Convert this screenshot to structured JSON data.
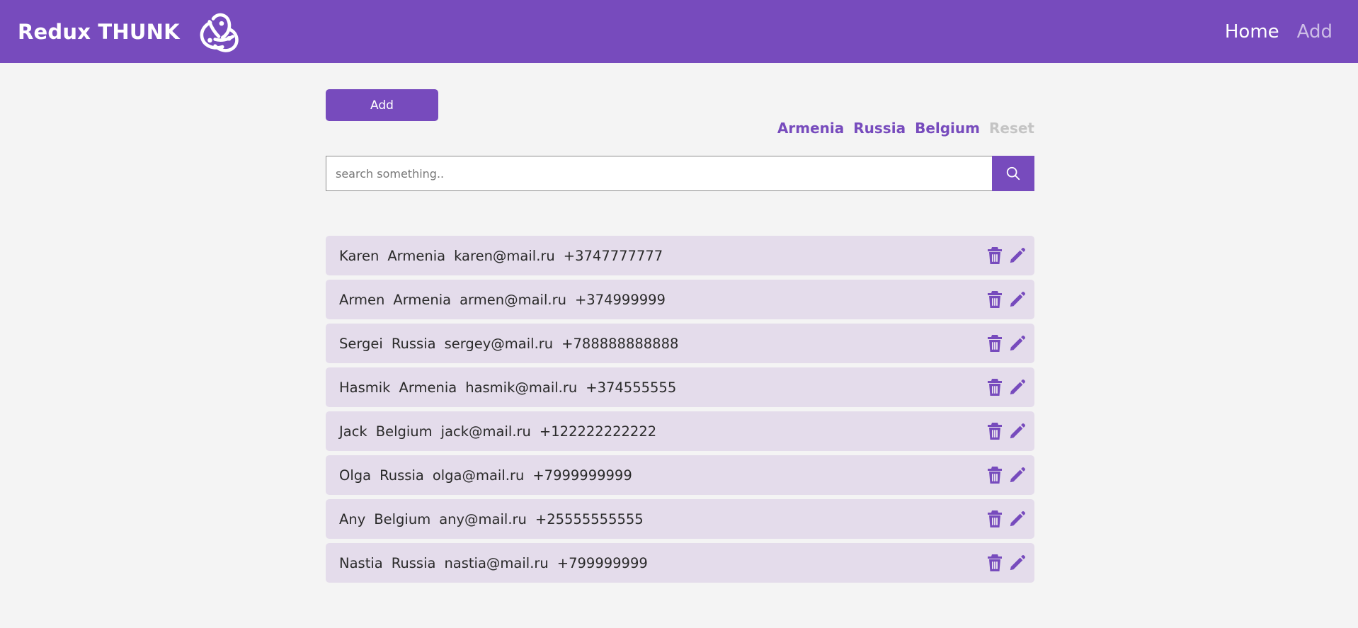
{
  "header": {
    "brand": "Redux THUNK",
    "nav": {
      "home": "Home",
      "add": "Add"
    }
  },
  "toolbar": {
    "add_label": "Add",
    "filters": [
      "Armenia",
      "Russia",
      "Belgium"
    ],
    "reset_label": "Reset"
  },
  "search": {
    "placeholder": "search something.."
  },
  "colors": {
    "accent": "#774bbd",
    "row_bg": "#e4dceb",
    "page_bg": "#f4f4f4"
  },
  "users": [
    {
      "name": "Karen",
      "country": "Armenia",
      "email": "karen@mail.ru",
      "phone": "+3747777777"
    },
    {
      "name": "Armen",
      "country": "Armenia",
      "email": "armen@mail.ru",
      "phone": "+374999999"
    },
    {
      "name": "Sergei",
      "country": "Russia",
      "email": "sergey@mail.ru",
      "phone": "+788888888888"
    },
    {
      "name": "Hasmik",
      "country": "Armenia",
      "email": "hasmik@mail.ru",
      "phone": "+374555555"
    },
    {
      "name": "Jack",
      "country": "Belgium",
      "email": "jack@mail.ru",
      "phone": "+122222222222"
    },
    {
      "name": "Olga",
      "country": "Russia",
      "email": "olga@mail.ru",
      "phone": "+7999999999"
    },
    {
      "name": "Any",
      "country": "Belgium",
      "email": "any@mail.ru",
      "phone": "+25555555555"
    },
    {
      "name": "Nastia",
      "country": "Russia",
      "email": "nastia@mail.ru",
      "phone": "+799999999"
    }
  ]
}
